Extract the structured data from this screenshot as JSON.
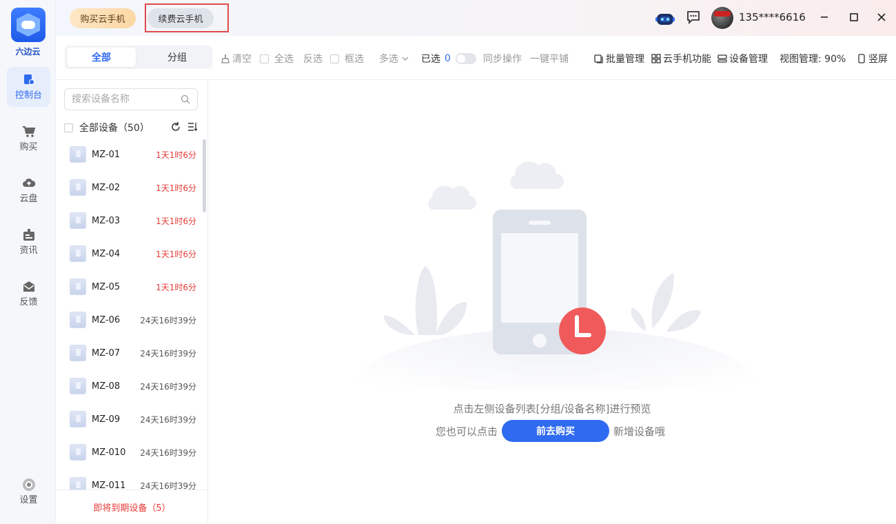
{
  "app": {
    "name": "六边云",
    "logo_icon": "hexagon-cloud-icon",
    "accent": "#2f6bf0"
  },
  "nav": {
    "items": [
      {
        "label": "控制台",
        "icon": "console-icon",
        "active": true
      },
      {
        "label": "购买",
        "icon": "cart-icon"
      },
      {
        "label": "云盘",
        "icon": "cloud-upload-icon"
      },
      {
        "label": "资讯",
        "icon": "news-icon"
      },
      {
        "label": "反馈",
        "icon": "mail-icon"
      }
    ],
    "settings": "设置"
  },
  "topbar": {
    "buy": "购买云手机",
    "renew": "续费云手机",
    "user": "135****6616"
  },
  "toolbar": {
    "tab_all": "全部",
    "tab_group": "分组",
    "clear": "清空",
    "select_all": "全选",
    "invert": "反选",
    "box_select": "框选",
    "multi_select": "多选",
    "selected_label": "已选",
    "selected_count": "0",
    "sync": "同步操作",
    "tile": "一键平铺",
    "batch": "批量管理",
    "phone_features": "云手机功能",
    "device_mgmt": "设备管理",
    "view_mgmt": "视图管理: 90%",
    "portrait": "竖屏"
  },
  "device_panel": {
    "search_placeholder": "搜索设备名称",
    "all_devices": "全部设备（50）",
    "expiring": "即将到期设备（5）",
    "devices": [
      {
        "name": "MZ-01",
        "time": "1天1时6分",
        "warn": true
      },
      {
        "name": "MZ-02",
        "time": "1天1时6分",
        "warn": true
      },
      {
        "name": "MZ-03",
        "time": "1天1时6分",
        "warn": true
      },
      {
        "name": "MZ-04",
        "time": "1天1时6分",
        "warn": true
      },
      {
        "name": "MZ-05",
        "time": "1天1时6分",
        "warn": true
      },
      {
        "name": "MZ-06",
        "time": "24天16时39分",
        "warn": false
      },
      {
        "name": "MZ-07",
        "time": "24天16时39分",
        "warn": false
      },
      {
        "name": "MZ-08",
        "time": "24天16时39分",
        "warn": false
      },
      {
        "name": "MZ-09",
        "time": "24天16时39分",
        "warn": false
      },
      {
        "name": "MZ-010",
        "time": "24天16时39分",
        "warn": false
      },
      {
        "name": "MZ-011",
        "time": "24天16时39分",
        "warn": false
      }
    ]
  },
  "main": {
    "hint_line1": "点击左侧设备列表[分组/设备名称]进行预览",
    "hint_prefix": "您也可以点击",
    "go_buy": "前去购买",
    "hint_suffix": "新增设备哦"
  }
}
